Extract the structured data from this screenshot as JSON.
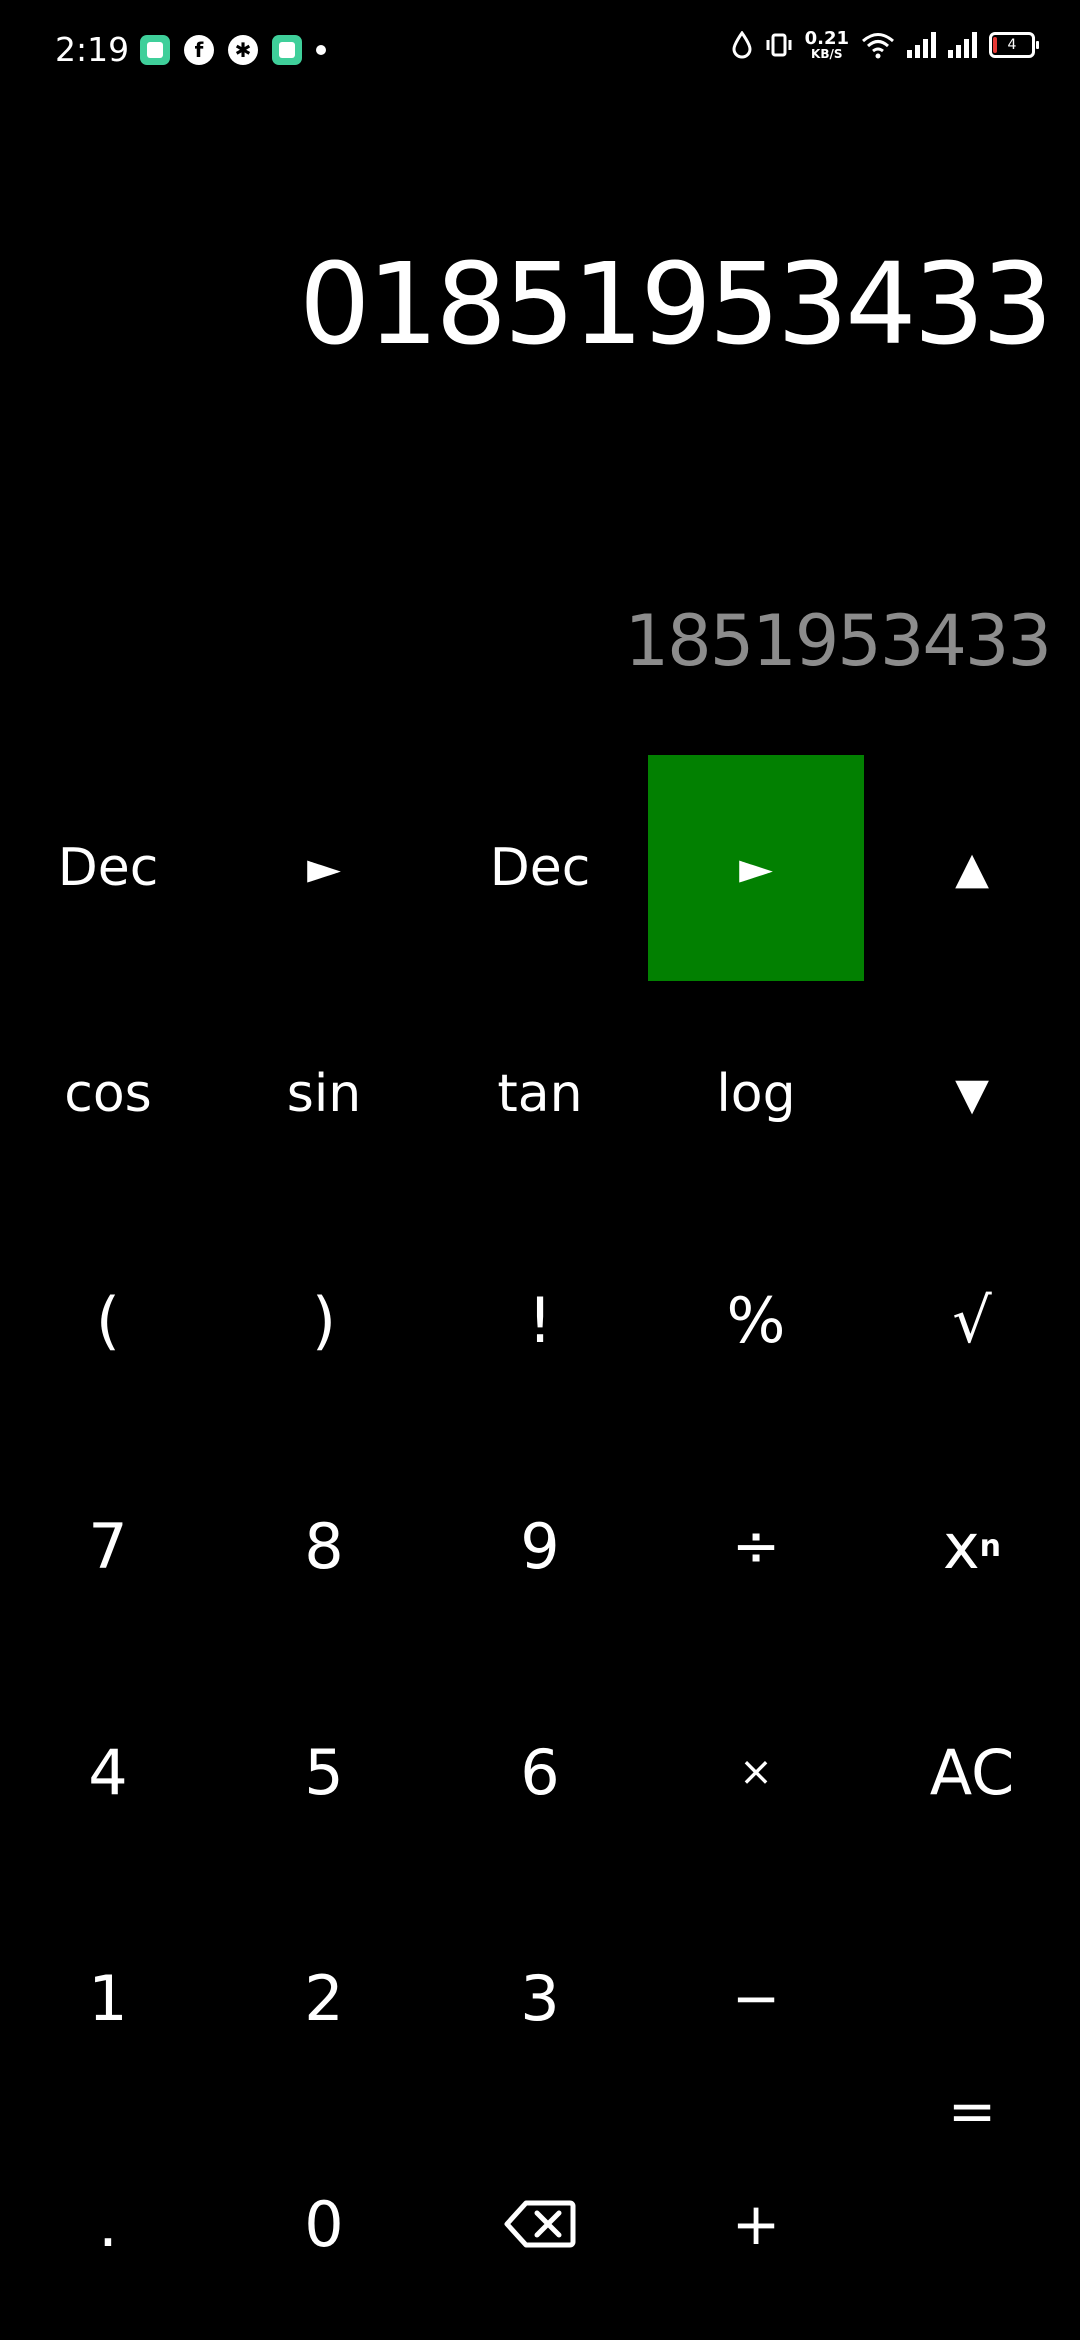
{
  "status_bar": {
    "time": "2:19",
    "net_speed_value": "0.21",
    "net_speed_unit": "KB/S",
    "battery_level": "4",
    "icons": [
      "app-icon",
      "facebook-icon",
      "settings-icon",
      "app-icon-2",
      "dot-icon",
      "water-drop-icon",
      "vibrate-icon",
      "wifi-icon",
      "signal-icon",
      "signal-icon-2",
      "battery-icon"
    ]
  },
  "display": {
    "expression": "01851953433",
    "result": "1851953433"
  },
  "colors": {
    "background": "#000000",
    "text": "#ffffff",
    "result_text": "#8c8c8c",
    "active_key": "#028001"
  },
  "keys": {
    "r1": [
      "Dec",
      "►",
      "Dec",
      "►",
      "▲"
    ],
    "r2": [
      "cos",
      "sin",
      "tan",
      "log",
      "▼"
    ],
    "r3": [
      "(",
      ")",
      "!",
      "%",
      "√"
    ],
    "r4": [
      "7",
      "8",
      "9",
      "÷",
      "x",
      "n"
    ],
    "r5": [
      "4",
      "5",
      "6",
      "×",
      "AC"
    ],
    "r6": [
      "1",
      "2",
      "3",
      "−"
    ],
    "r7": [
      ".",
      "0",
      "+"
    ],
    "equals": "="
  }
}
